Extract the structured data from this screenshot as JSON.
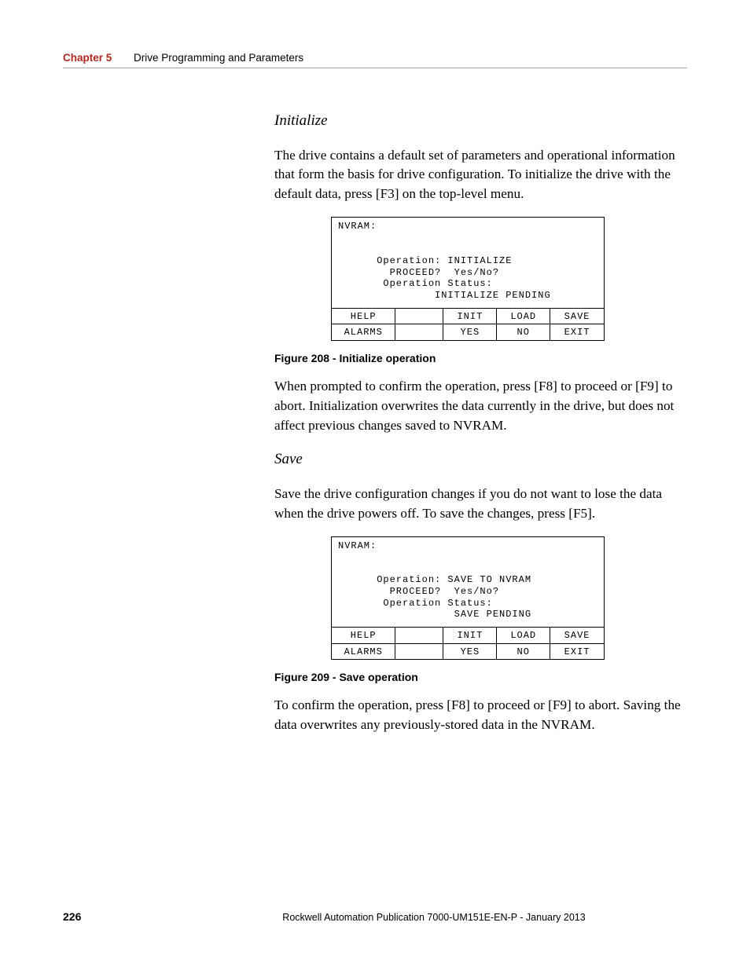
{
  "header": {
    "chapter_label": "Chapter 5",
    "chapter_title": "Drive Programming and Parameters"
  },
  "sections": {
    "init": {
      "title": "Initialize",
      "para1": "The drive contains a default set of parameters and operational information that form the basis for drive configuration. To initialize the drive with the default data, press [F3] on the top-level menu.",
      "caption": "Figure 208 - Initialize operation",
      "para2": "When prompted to confirm the operation, press [F8] to proceed or [F9] to abort. Initialization overwrites the data currently in the drive, but does not affect previous changes saved to NVRAM."
    },
    "save": {
      "title": "Save",
      "para1": "Save the drive configuration changes if you do not want to lose the data when the drive powers off. To save the changes, press [F5].",
      "caption": "Figure 209 - Save operation",
      "para2": "To confirm the operation, press [F8] to proceed or [F9] to abort. Saving the data overwrites any previously-stored data in the NVRAM."
    }
  },
  "terminal": {
    "init_screen": "NVRAM:\n\n\n      Operation: INITIALIZE\n        PROCEED?  Yes/No?\n       Operation Status:\n               INITIALIZE PENDING",
    "save_screen": "NVRAM:\n\n\n      Operation: SAVE TO NVRAM\n        PROCEED?  Yes/No?\n       Operation Status:\n                  SAVE PENDING",
    "row1": {
      "c1": "HELP",
      "c2": "",
      "c3": "INIT",
      "c4": "LOAD",
      "c5": "SAVE"
    },
    "row2": {
      "c1": "ALARMS",
      "c2": "",
      "c3": "YES",
      "c4": "NO",
      "c5": "EXIT"
    }
  },
  "footer": {
    "page": "226",
    "pub": "Rockwell Automation Publication 7000-UM151E-EN-P - January 2013"
  }
}
